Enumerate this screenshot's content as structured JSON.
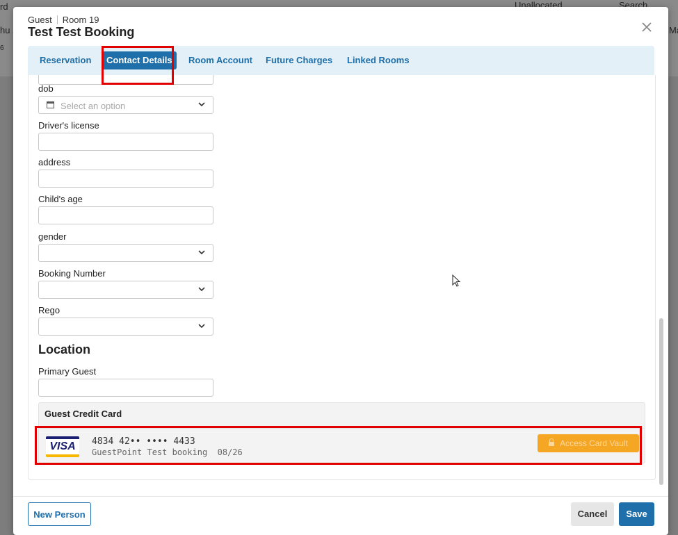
{
  "background": {
    "left_fragments": [
      "rd",
      "hu 2",
      "6"
    ],
    "top_right": {
      "filter_label": "Unallocated",
      "search_label": "Search",
      "right_fragment": "Ma"
    }
  },
  "header": {
    "guest_label": "Guest",
    "room_label": "Room 19",
    "title": "Test Test Booking"
  },
  "tabs": [
    {
      "label": "Reservation",
      "active": false
    },
    {
      "label": "Contact Details",
      "active": true
    },
    {
      "label": "Room Account",
      "active": false
    },
    {
      "label": "Future Charges",
      "active": false
    },
    {
      "label": "Linked Rooms",
      "active": false
    }
  ],
  "form": {
    "fields": [
      {
        "label": "dob",
        "type": "date-select",
        "placeholder": "Select an option"
      },
      {
        "label": "Driver's license",
        "type": "text",
        "value": ""
      },
      {
        "label": "address",
        "type": "text",
        "value": ""
      },
      {
        "label": "Child's age",
        "type": "text",
        "value": ""
      },
      {
        "label": "gender",
        "type": "select",
        "value": ""
      },
      {
        "label": "Booking Number",
        "type": "select",
        "value": ""
      },
      {
        "label": "Rego",
        "type": "select",
        "value": ""
      }
    ],
    "location_title": "Location",
    "primary_guest_label": "Primary Guest"
  },
  "credit_card": {
    "section_title": "Guest Credit Card",
    "brand": "VISA",
    "number": "4834 42•• •••• 4433",
    "holder": "GuestPoint Test booking",
    "expiry": "08/26",
    "vault_button": "Access Card Vault"
  },
  "footer": {
    "new_person": "New Person",
    "cancel": "Cancel",
    "save": "Save"
  },
  "colors": {
    "primary": "#1f6fab",
    "tab_bar": "#e3f0f8",
    "vault_button": "#f5a623",
    "highlight": "#e00000"
  },
  "icons": [
    "close-icon",
    "calendar-icon",
    "chevron-down-icon",
    "lock-icon",
    "visa-logo",
    "mouse-cursor-icon"
  ]
}
